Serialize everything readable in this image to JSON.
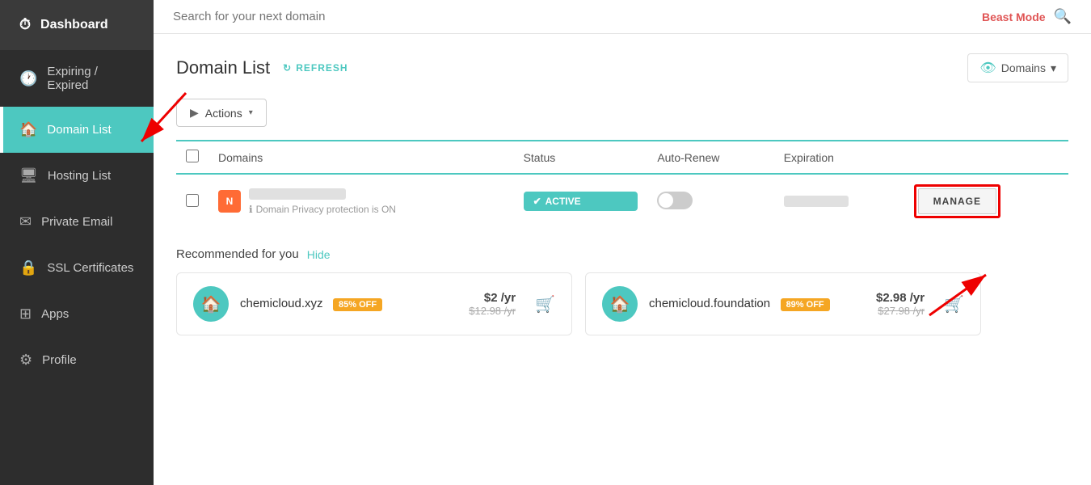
{
  "sidebar": {
    "logo": "⏱",
    "items": [
      {
        "id": "dashboard",
        "label": "Dashboard",
        "icon": "⏱",
        "active": false
      },
      {
        "id": "expiring",
        "label": "Expiring / Expired",
        "icon": "🕐",
        "active": false
      },
      {
        "id": "domain-list",
        "label": "Domain List",
        "icon": "🏠",
        "active": true
      },
      {
        "id": "hosting-list",
        "label": "Hosting List",
        "icon": "🖥",
        "active": false
      },
      {
        "id": "private-email",
        "label": "Private Email",
        "icon": "✉",
        "active": false
      },
      {
        "id": "ssl",
        "label": "SSL Certificates",
        "icon": "🔒",
        "active": false
      },
      {
        "id": "apps",
        "label": "Apps",
        "icon": "⊞",
        "active": false
      },
      {
        "id": "profile",
        "label": "Profile",
        "icon": "⚙",
        "active": false
      }
    ]
  },
  "search": {
    "placeholder": "Search for your next domain",
    "beast_mode": "Beast Mode"
  },
  "main": {
    "title": "Domain List",
    "refresh_label": "REFRESH",
    "domains_dropdown": "Domains",
    "actions_label": "Actions",
    "table": {
      "headers": [
        "Domains",
        "Status",
        "Auto-Renew",
        "Expiration"
      ],
      "rows": [
        {
          "icon": "N",
          "domain_name": "",
          "privacy_text": "Domain Privacy protection is ON",
          "status": "ACTIVE",
          "manage_label": "MANAGE"
        }
      ]
    },
    "recommended": {
      "title": "Recommended for you",
      "hide_label": "Hide",
      "items": [
        {
          "domain": "chemicloud.xyz",
          "badge": "85% OFF",
          "price": "$2 /yr",
          "old_price": "$12.98 /yr"
        },
        {
          "domain": "chemicloud.foundation",
          "badge": "89% OFF",
          "price": "$2.98 /yr",
          "old_price": "$27.98 /yr"
        }
      ]
    }
  }
}
